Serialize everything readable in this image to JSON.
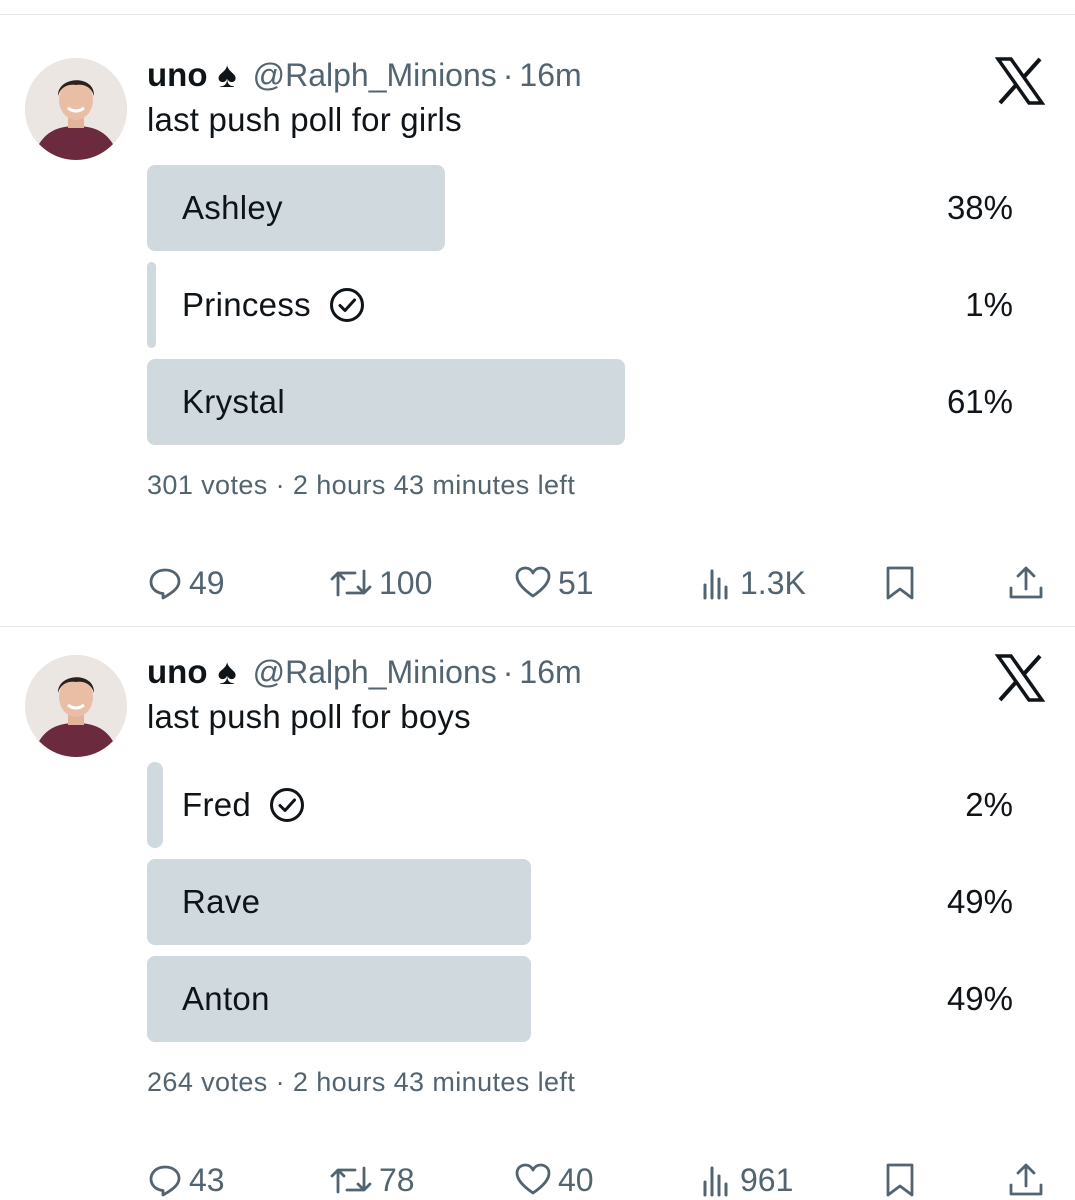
{
  "tweets": [
    {
      "author": {
        "name": "uno",
        "emoji": "♠",
        "handle": "@Ralph_Minions",
        "time": "16m",
        "separator": "·"
      },
      "text": "last push poll for girls",
      "poll": {
        "options": [
          {
            "label": "Ashley",
            "percent_text": "38%",
            "percent": 38,
            "selected": false
          },
          {
            "label": "Princess",
            "percent_text": "1%",
            "percent": 1,
            "selected": true
          },
          {
            "label": "Krystal",
            "percent_text": "61%",
            "percent": 61,
            "selected": false
          }
        ],
        "meta": "301 votes · 2 hours 43 minutes left"
      },
      "actions": {
        "replies": "49",
        "reposts": "100",
        "likes": "51",
        "views": "1.3K"
      },
      "icon": "x-logo"
    },
    {
      "author": {
        "name": "uno",
        "emoji": "♠",
        "handle": "@Ralph_Minions",
        "time": "16m",
        "separator": "·"
      },
      "text": "last push poll for boys",
      "poll": {
        "options": [
          {
            "label": "Fred",
            "percent_text": "2%",
            "percent": 2,
            "selected": true
          },
          {
            "label": "Rave",
            "percent_text": "49%",
            "percent": 49,
            "selected": false
          },
          {
            "label": "Anton",
            "percent_text": "49%",
            "percent": 49,
            "selected": false
          }
        ],
        "meta": "264 votes · 2 hours 43 minutes left"
      },
      "actions": {
        "replies": "43",
        "reposts": "78",
        "likes": "40",
        "views": "961"
      },
      "icon": "x-logo"
    }
  ],
  "colors": {
    "bar": "#cfd9de",
    "text": "#0f1419",
    "secondary": "#536471",
    "divider": "#e1e4e8"
  }
}
